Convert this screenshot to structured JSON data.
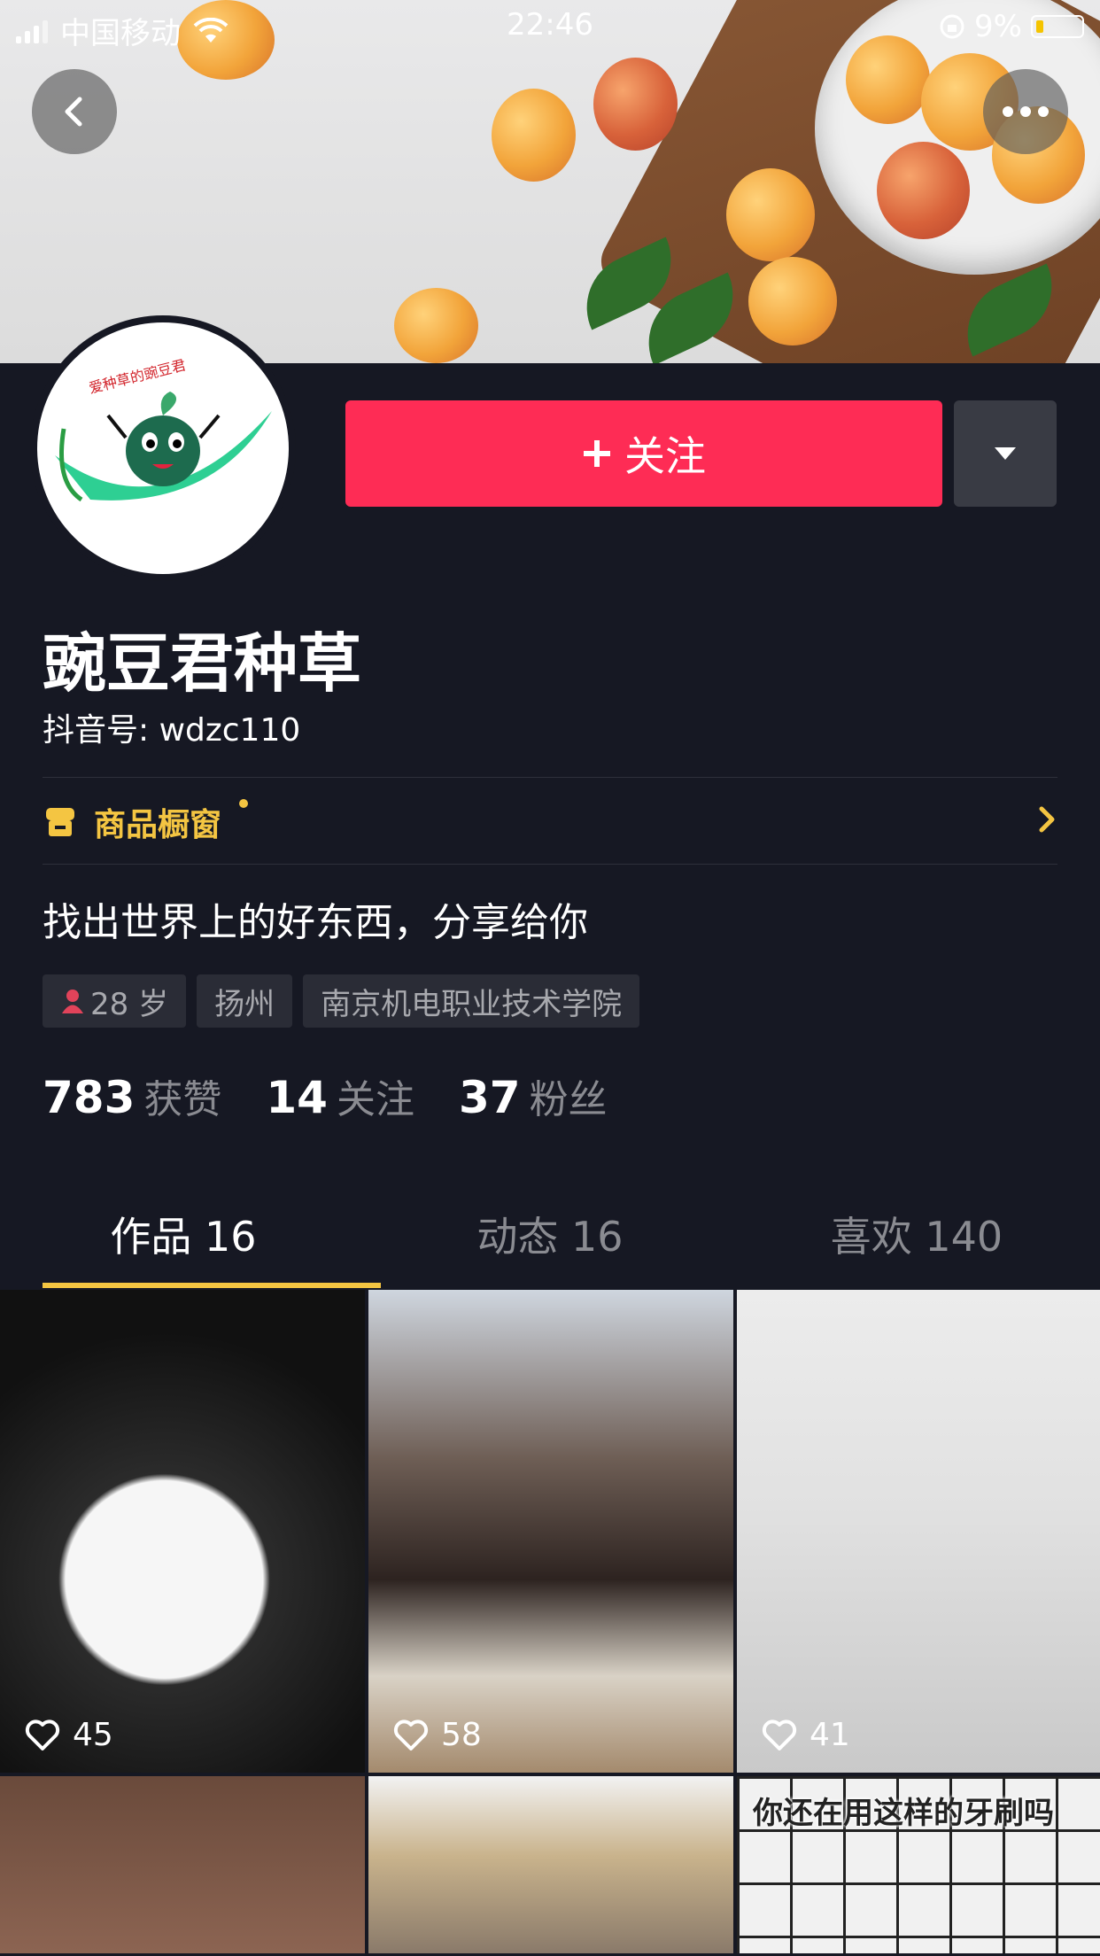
{
  "status_bar": {
    "carrier": "中国移动",
    "time": "22:46",
    "battery": "9%"
  },
  "profile": {
    "follow_label": "关注",
    "name": "豌豆君种草",
    "handle": "抖音号: wdzc110",
    "shop_label": "商品橱窗",
    "bio": "找出世界上的好东西，分享给你",
    "tags": [
      "28 岁",
      "扬州",
      "南京机电职业技术学院"
    ],
    "stats": [
      {
        "num": "783",
        "label": "获赞"
      },
      {
        "num": "14",
        "label": "关注"
      },
      {
        "num": "37",
        "label": "粉丝"
      }
    ]
  },
  "tabs": [
    {
      "label": "作品 16"
    },
    {
      "label": "动态 16"
    },
    {
      "label": "喜欢 140"
    }
  ],
  "videos": [
    {
      "likes": "45"
    },
    {
      "likes": "58"
    },
    {
      "likes": "41"
    },
    {
      "likes": ""
    },
    {
      "likes": ""
    },
    {
      "caption": "你还在用这样的牙刷吗"
    }
  ],
  "colors": {
    "accent": "#fe2c55",
    "background": "#161823",
    "shop": "#f4c542"
  }
}
